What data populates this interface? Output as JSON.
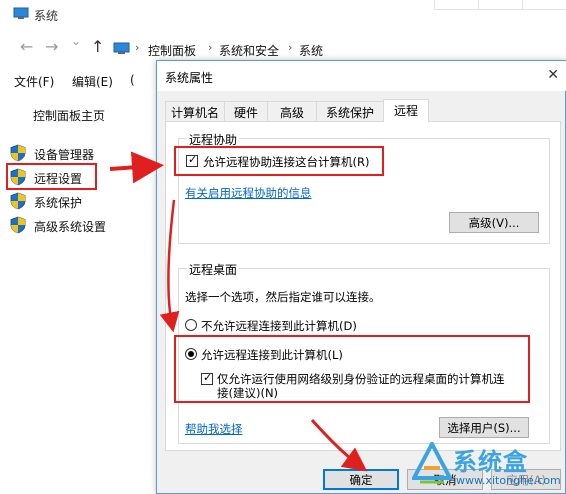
{
  "window": {
    "title": "系统"
  },
  "nav": {
    "back": "←",
    "forward": "→",
    "dropdown": "⌄",
    "up": "↑",
    "breadcrumbs": [
      "控制面板",
      "系统和安全",
      "系统"
    ],
    "separator": "›"
  },
  "menu": {
    "items": [
      "文件(F)",
      "编辑(E)"
    ]
  },
  "sidebar": {
    "home": "控制面板主页",
    "items": [
      {
        "label": "设备管理器",
        "icon": "shield-icon"
      },
      {
        "label": "远程设置",
        "icon": "shield-icon"
      },
      {
        "label": "系统保护",
        "icon": "shield-icon"
      },
      {
        "label": "高级系统设置",
        "icon": "shield-icon"
      }
    ]
  },
  "dialog": {
    "title": "系统属性",
    "close": "✕",
    "tabs": [
      "计算机名",
      "硬件",
      "高级",
      "系统保护",
      "远程"
    ],
    "active_tab": "远程",
    "remote_assist": {
      "group_label": "远程协助",
      "allow_label": "允许远程协助连接这台计算机(R)",
      "allow_checked": true,
      "info_link": "有关启用远程协助的信息",
      "advanced_button": "高级(V)..."
    },
    "remote_desktop": {
      "group_label": "远程桌面",
      "instruction": "选择一个选项，然后指定谁可以连接。",
      "option_deny": "不允许远程连接到此计算机(D)",
      "option_allow": "允许远程连接到此计算机(L)",
      "selected": "option_allow",
      "nla_label_line1": "仅允许运行使用网络级别身份验证的远程桌面的计算机连",
      "nla_label_line2": "接(建议)(N)",
      "nla_checked": true,
      "help_link": "帮助我选择",
      "select_users_button": "选择用户(S)..."
    },
    "ok_button": "确定",
    "cancel_button": "取消",
    "apply_button": "应用(A)"
  },
  "watermark": {
    "text": "系统盒",
    "url": "www.xitonghe.com"
  },
  "colors": {
    "highlight_red": "#e0201e",
    "link_blue": "#0066cc",
    "dialog_border": "#5d9ad6",
    "watermark_blue": "#3aa3e3"
  }
}
